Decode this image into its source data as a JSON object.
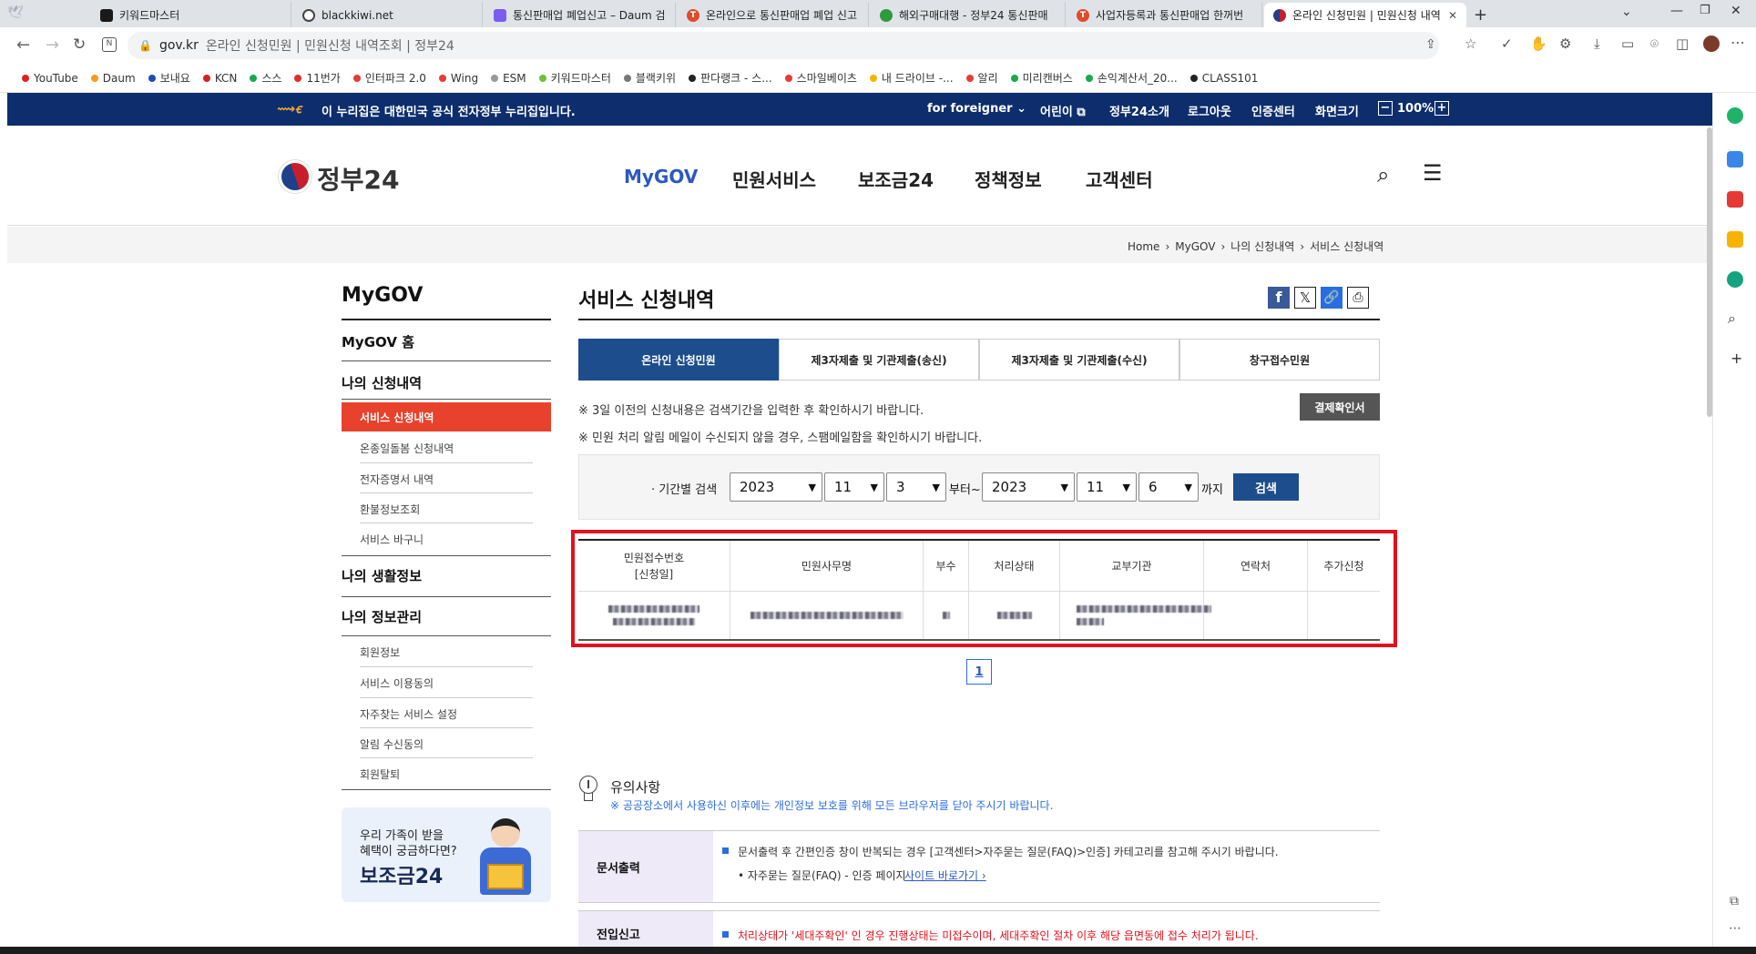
{
  "browser": {
    "tabs": [
      {
        "label": "키워드마스터",
        "color": "#1a1a1a"
      },
      {
        "label": "blackkiwi.net",
        "color": "#444"
      },
      {
        "label": "통신판매업 폐업신고 – Daum 검",
        "color": "#7a5cf0"
      },
      {
        "label": "온라인으로 통신판매업 폐업 신고",
        "color": "#e04b2b"
      },
      {
        "label": "해외구매대행 - 정부24 통신판매",
        "color": "#2e9a3e"
      },
      {
        "label": "사업자등록과 통신판매업 한꺼번",
        "color": "#e04b2b"
      },
      {
        "label": "온라인 신청민원 | 민원신청 내역",
        "color": "#c81e2c"
      }
    ],
    "new_tab": "+",
    "url_domain": "gov.kr",
    "url_title": "온라인 신청민원 | 민원신청 내역조회 | 정부24",
    "bookmarks": [
      {
        "label": "YouTube",
        "color": "#e02020"
      },
      {
        "label": "Daum",
        "color": "#f59b1c"
      },
      {
        "label": "보내요",
        "color": "#1f4bb3"
      },
      {
        "label": "KCN",
        "color": "#d62020"
      },
      {
        "label": "스스",
        "color": "#18a94b"
      },
      {
        "label": "11번가",
        "color": "#e42a2a"
      },
      {
        "label": "인터파크 2.0",
        "color": "#e83a3a"
      },
      {
        "label": "Wing",
        "color": "#e83a3a"
      },
      {
        "label": "ESM",
        "color": "#999"
      },
      {
        "label": "키워드마스터",
        "color": "#6bbf3a"
      },
      {
        "label": "블랙키위",
        "color": "#777"
      },
      {
        "label": "판다랭크 - 스...",
        "color": "#222"
      },
      {
        "label": "스마일베이츠",
        "color": "#e83a3a"
      },
      {
        "label": "내 드라이브 -...",
        "color": "#f4b400"
      },
      {
        "label": "알리",
        "color": "#e83a3a"
      },
      {
        "label": "미리캔버스",
        "color": "#18a94b"
      },
      {
        "label": "손익계산서_20...",
        "color": "#18a94b"
      },
      {
        "label": "CLASS101",
        "color": "#222"
      }
    ]
  },
  "gov_banner": {
    "text": "이 누리집은 대한민국 공식 전자정부 누리집입니다.",
    "links": [
      "for foreigner",
      "어린이",
      "정부24소개",
      "로그아웃",
      "인증센터",
      "화면크기"
    ],
    "zoom": "100%"
  },
  "header": {
    "logo": "정부24",
    "nav": [
      "MyGOV",
      "민원서비스",
      "보조금24",
      "정책정보",
      "고객센터"
    ]
  },
  "breadcrumb": [
    "Home",
    "MyGOV",
    "나의 신청내역",
    "서비스 신청내역"
  ],
  "sidebar": {
    "title": "MyGOV",
    "home": "MyGOV 홈",
    "sec1": "나의 신청내역",
    "sec1_items": [
      "서비스 신청내역",
      "온종일돌봄 신청내역",
      "전자증명서 내역",
      "환불정보조회",
      "서비스 바구니"
    ],
    "sec2": "나의 생활정보",
    "sec3": "나의 정보관리",
    "sec3_items": [
      "회원정보",
      "서비스 이용동의",
      "자주찾는 서비스 설정",
      "알림 수신동의",
      "회원탈퇴"
    ],
    "promo_l1": "우리 가족이 받을",
    "promo_l2": "혜택이 궁금하다면?",
    "promo_l3": "보조금24"
  },
  "main": {
    "title": "서비스 신청내역",
    "tabs": [
      "온라인 신청민원",
      "제3자제출 및 기관제출(송신)",
      "제3자제출 및 기관제출(수신)",
      "창구접수민원"
    ],
    "notice1": "※ 3일 이전의 신청내용은 검색기간을 입력한 후 확인하시기 바랍니다.",
    "notice2": "※ 민원 처리 알림 메일이 수신되지 않을 경우, 스팸메일함을 확인하시기 바랍니다.",
    "payment_btn": "결제확인서",
    "search": {
      "label": "· 기간별 검색",
      "from": [
        "2023",
        "11",
        "3"
      ],
      "from_suffix": "부터~",
      "to": [
        "2023",
        "11",
        "6"
      ],
      "to_suffix": "까지",
      "button": "검색"
    },
    "table_headers": [
      "민원접수번호\n[신청일]",
      "민원사무명",
      "부수",
      "처리상태",
      "교부기관",
      "연락처",
      "추가신청"
    ],
    "page": "1",
    "caution_title": "유의사항",
    "caution_sub": "※ 공공장소에서 사용하신 이후에는 개인정보 보호를 위해 모든 브라우저를 닫아 주시기 바랍니다.",
    "doc_label": "문서출력",
    "doc_text": "문서출력 후 간편인증 창이 반복되는 경우 [고객센터>자주묻는 질문(FAQ)>인증] 카테고리를 참고해 주시기 바랍니다.",
    "doc_sub": "자주묻는 질문(FAQ) - 인증 페이지",
    "doc_link": "사이트 바로가기",
    "move_label": "전입신고",
    "move_text": "처리상태가 '세대주확인' 인 경우 진행상태는 미접수이며, 세대주확인 절차 이후 해당 읍면동에 접수 처리가 됩니다."
  },
  "colors": {
    "gov_navy": "#0d2d6c",
    "active_red": "#e8412c",
    "tab_blue": "#1d4d8c",
    "highlight": "#e3101c"
  }
}
